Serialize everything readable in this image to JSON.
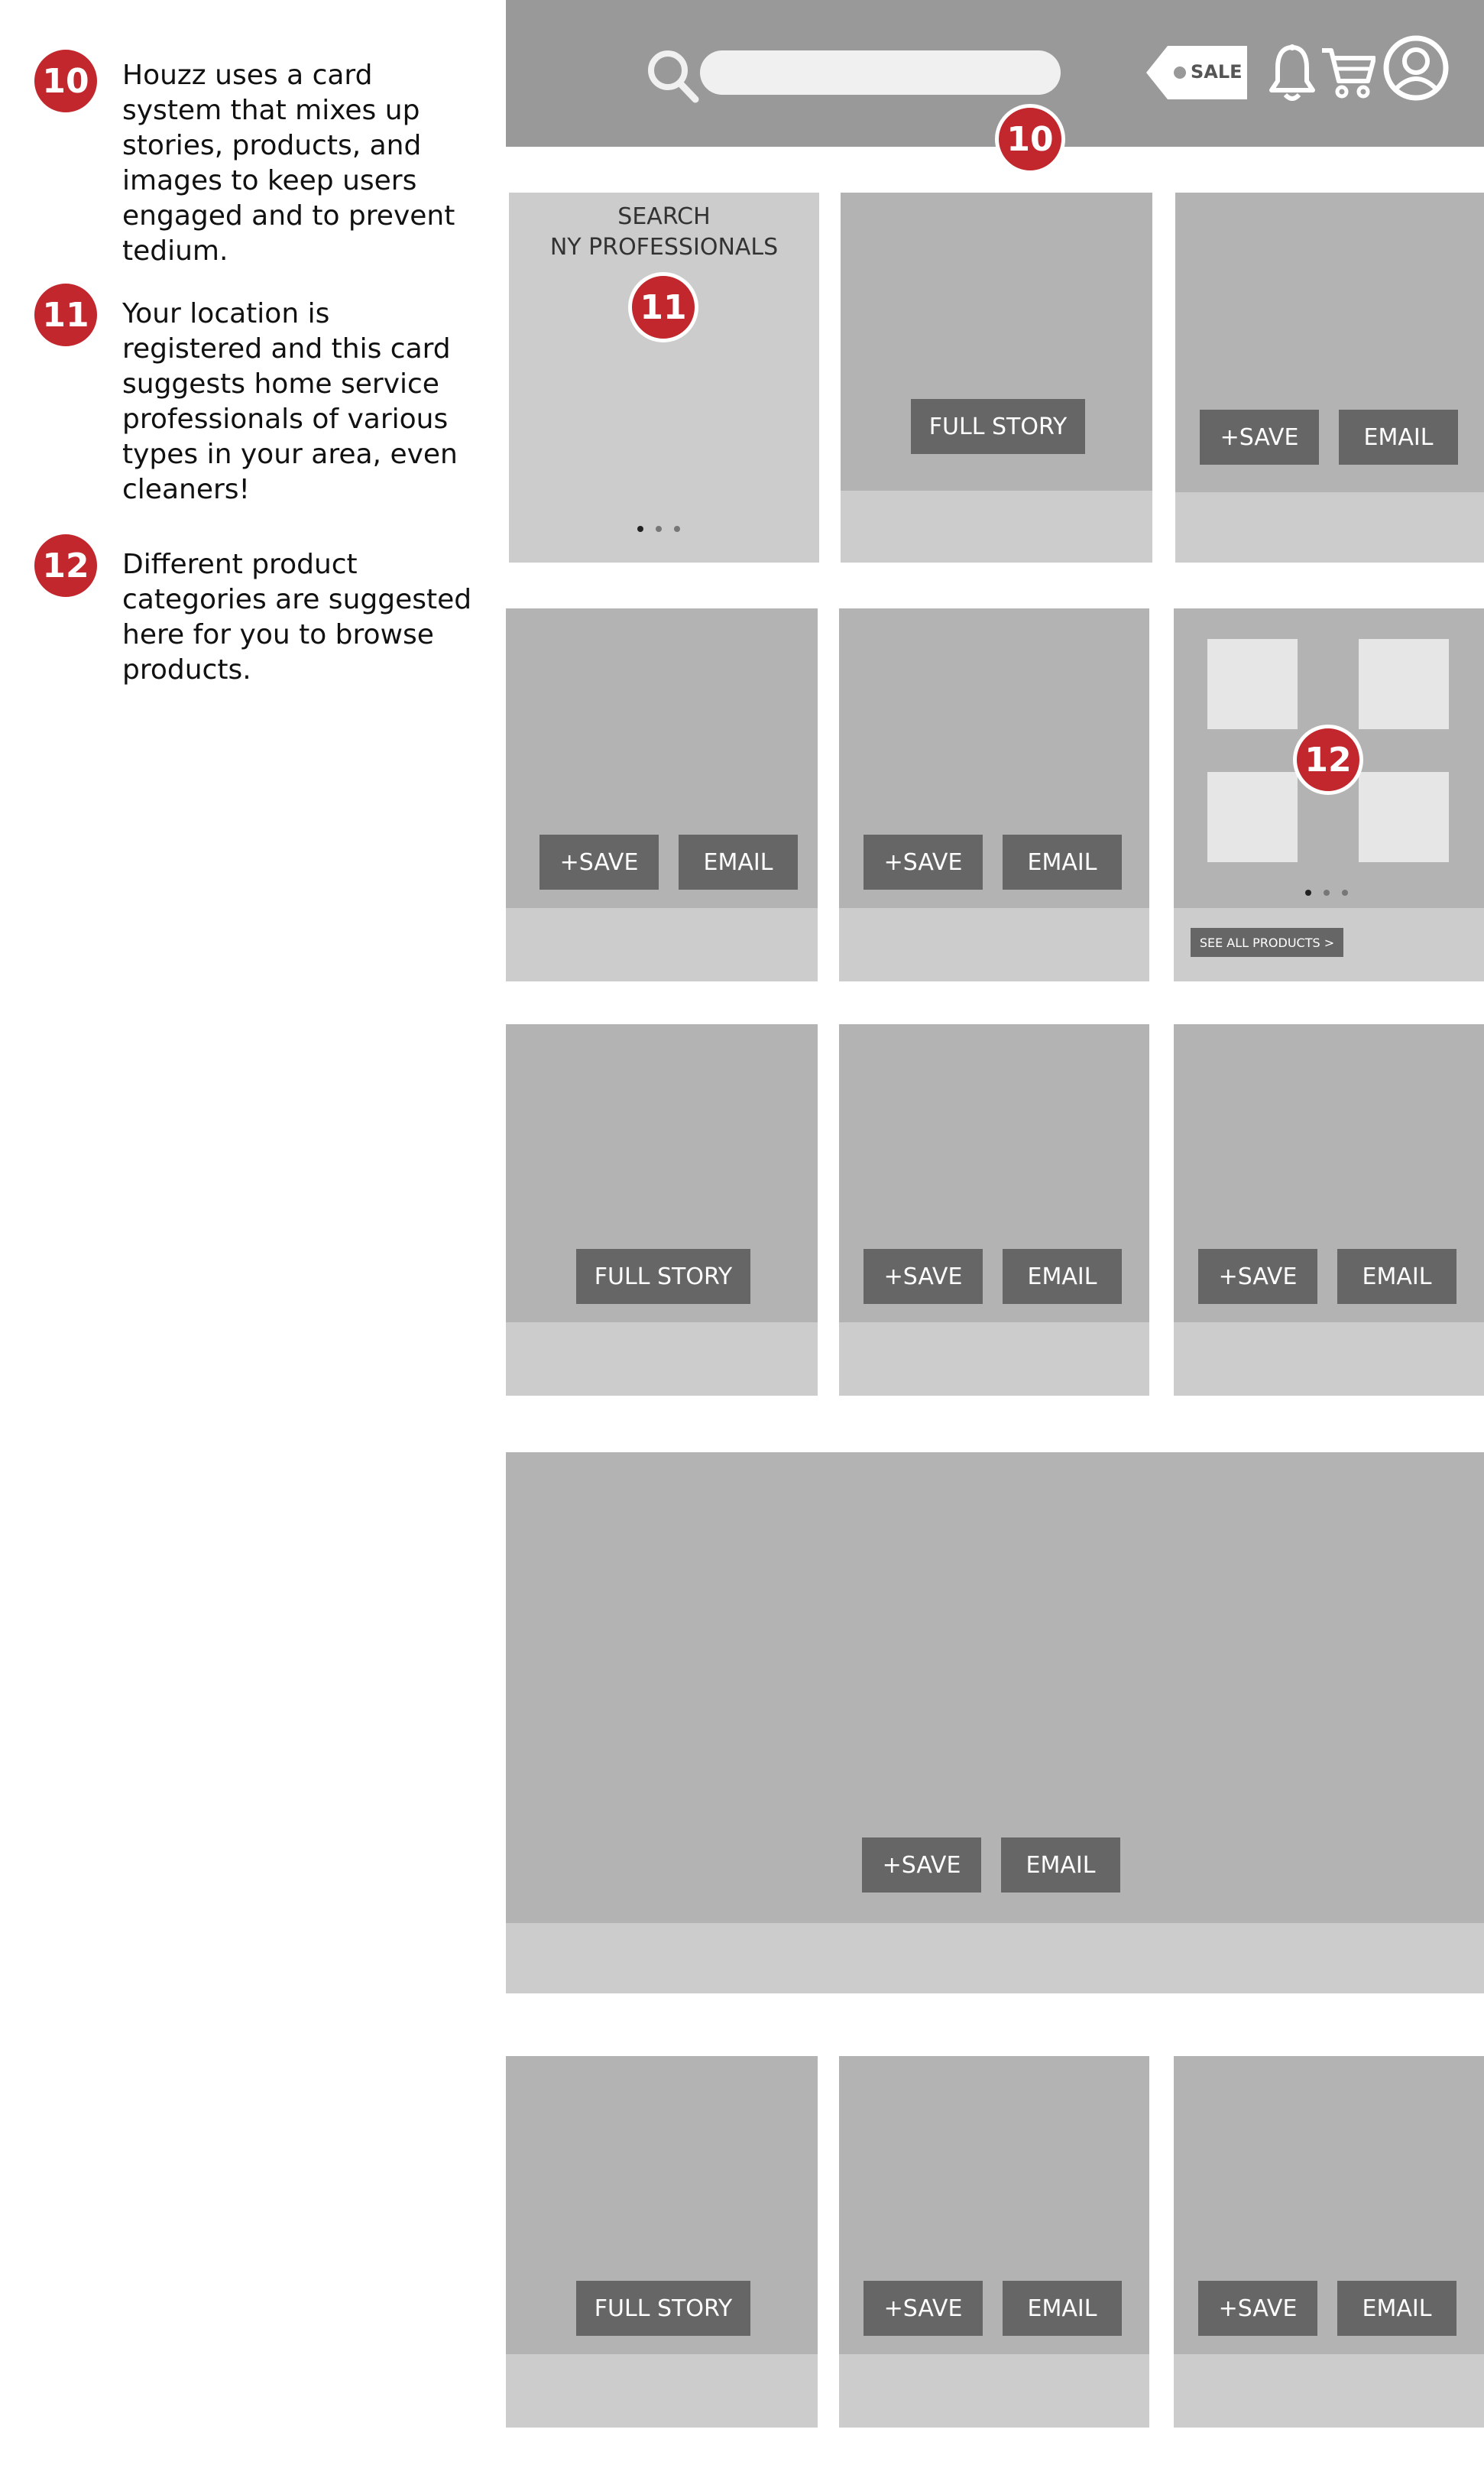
{
  "annotations": [
    {
      "number": "10",
      "text": "Houzz uses a card system that mixes up stories, products, and images to keep users engaged and to prevent tedium."
    },
    {
      "number": "11",
      "text": "Your location is registered and this card suggests home service professionals of various types in your area, even cleaners!"
    },
    {
      "number": "12",
      "text": "Different product categories are suggested here for you to browse products."
    }
  ],
  "header": {
    "sale_label": "SALE",
    "badge_number": "10",
    "icons": [
      "search-icon",
      "sale-tag-icon",
      "bell-icon",
      "cart-icon",
      "user-icon"
    ]
  },
  "cards": {
    "professionals": {
      "line1": "SEARCH",
      "line2": "NY PROFESSIONALS",
      "badge": "11"
    },
    "products_badge": "12",
    "see_all_label": "SEE ALL PRODUCTS >"
  },
  "buttons": {
    "save": "+SAVE",
    "email": "EMAIL",
    "full_story": "FULL STORY"
  },
  "colors": {
    "accent_red": "#c1272d",
    "topbar_gray": "#999999",
    "card_gray": "#b3b3b3",
    "footer_gray": "#cccccc",
    "button_gray": "#666666"
  }
}
